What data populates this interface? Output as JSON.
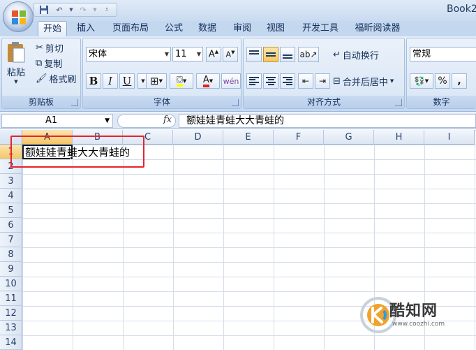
{
  "window": {
    "title": "Book2"
  },
  "tabs": [
    {
      "label": "开始",
      "active": true
    },
    {
      "label": "插入"
    },
    {
      "label": "页面布局"
    },
    {
      "label": "公式"
    },
    {
      "label": "数据"
    },
    {
      "label": "审阅"
    },
    {
      "label": "视图"
    },
    {
      "label": "开发工具"
    },
    {
      "label": "福昕阅读器"
    }
  ],
  "clipboard": {
    "paste": "粘贴",
    "cut": "剪切",
    "copy": "复制",
    "format_painter": "格式刷",
    "label": "剪贴板"
  },
  "font": {
    "name": "宋体",
    "size": "11",
    "bold": "B",
    "italic": "I",
    "underline": "U",
    "label": "字体"
  },
  "alignment": {
    "wrap_text": "自动换行",
    "merge_center": "合并后居中",
    "label": "对齐方式"
  },
  "number": {
    "format": "常规",
    "percent": "%",
    "comma": ",",
    "label": "数字"
  },
  "formula_bar": {
    "name_box": "A1",
    "fx": "fx",
    "content": "额娃娃青蛙大大青蛙的"
  },
  "columns": [
    "A",
    "B",
    "C",
    "D",
    "E",
    "F",
    "G",
    "H",
    "I"
  ],
  "rows": [
    "1",
    "2",
    "3",
    "4",
    "5",
    "6",
    "7",
    "8",
    "9",
    "10",
    "11",
    "12",
    "13",
    "14"
  ],
  "cells": {
    "A1": "额娃娃青蛙大大青蛙的"
  },
  "watermark": {
    "title": "酷知网",
    "url": "www.coozhi.com"
  },
  "colors": {
    "highlight": "#e8232c",
    "selected_header": "#f5c767",
    "ribbon": "#d2e1f3"
  }
}
